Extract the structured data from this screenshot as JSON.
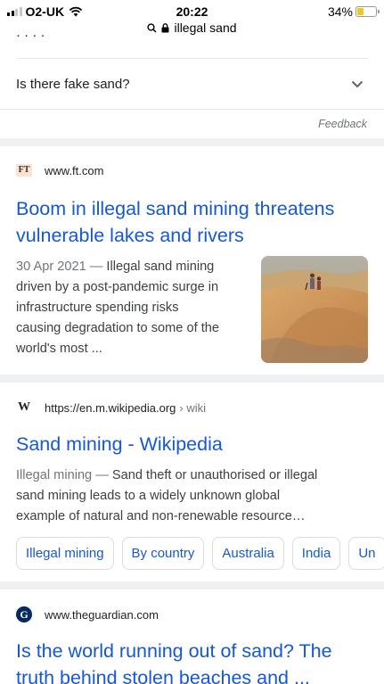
{
  "status_bar": {
    "carrier": "O2-UK",
    "time": "20:22",
    "battery": "34%",
    "battery_level": 0.34,
    "battery_color": "#f5c518",
    "url": "illegal sand"
  },
  "faq": {
    "question": "Is there fake sand?",
    "feedback": "Feedback"
  },
  "results": [
    {
      "favicon": "FT",
      "site": "www.ft.com",
      "title_line1": "Boom in illegal sand mining threatens",
      "title_line2": "vulnerable lakes and rivers",
      "date": "30 Apr 2021",
      "snippet_line1": "Illegal sand mining",
      "snippet_line2": "driven by a post-pandemic surge in",
      "snippet_line3": "infrastructure spending risks",
      "snippet_line4": "causing degradation to some of the",
      "snippet_line5": "world's most ..."
    },
    {
      "favicon": "W",
      "site": "https://en.m.wikipedia.org",
      "crumb": "› wiki",
      "title_line1": "Sand mining - Wikipedia",
      "date": "Illegal mining",
      "snippet_line1": "Sand theft or unauthorised or illegal",
      "snippet_line2": "sand mining leads to a widely unknown global",
      "snippet_line3": "example of natural and non-renewable resource…",
      "chips": [
        "Illegal mining",
        "By country",
        "Australia",
        "India",
        "Un"
      ]
    },
    {
      "favicon": "G",
      "site": "www.theguardian.com",
      "title_line1": "Is the world running out of sand? The",
      "title_line2": "truth behind stolen beaches and ..."
    }
  ],
  "colors": {
    "link": "#1558d6",
    "separator": "#eef0f2"
  }
}
